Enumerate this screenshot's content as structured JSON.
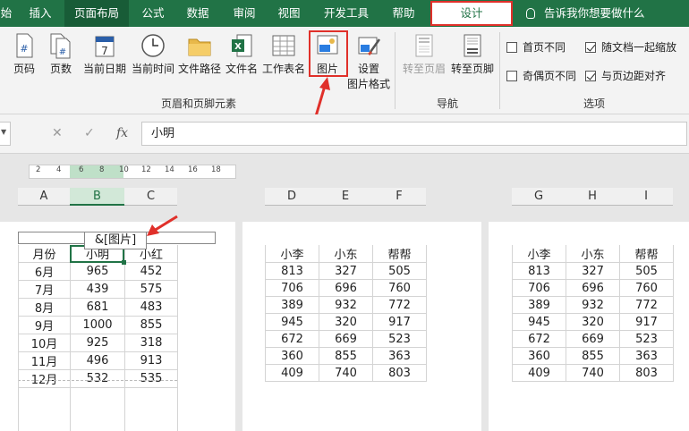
{
  "tabs": [
    "始",
    "插入",
    "页面布局",
    "公式",
    "数据",
    "审阅",
    "视图",
    "开发工具",
    "帮助",
    "设计"
  ],
  "tell_me": "告诉我你想要做什么",
  "ribbon": {
    "elements_buttons": [
      "页码",
      "页数",
      "当前日期",
      "当前时间",
      "文件路径",
      "文件名",
      "工作表名",
      "图片"
    ],
    "format_picture_line1": "设置",
    "format_picture_line2": "图片格式",
    "group_elements": "页眉和页脚元素",
    "nav_goto_header": "转至页眉",
    "nav_goto_footer": "转至页脚",
    "group_nav": "导航",
    "options": {
      "diff_first": "首页不同",
      "diff_odd_even": "奇偶页不同",
      "scale_with_doc": "随文档一起缩放",
      "align_margins": "与页边距对齐",
      "group": "选项"
    }
  },
  "formula": {
    "cancel": "✕",
    "enter": "✓",
    "fx": "fx",
    "value": "小明"
  },
  "ruler_ticks": [
    "2",
    "4",
    "6",
    "8",
    "10",
    "12",
    "14",
    "16",
    "18"
  ],
  "columns": [
    "A",
    "B",
    "C",
    "D",
    "E",
    "F",
    "G",
    "H",
    "I"
  ],
  "header_field": "&[图片]",
  "page1": {
    "headers": [
      "月份",
      "小明",
      "小红"
    ],
    "rows": [
      [
        "6月",
        "965",
        "452"
      ],
      [
        "7月",
        "439",
        "575"
      ],
      [
        "8月",
        "681",
        "483"
      ],
      [
        "9月",
        "1000",
        "855"
      ],
      [
        "10月",
        "925",
        "318"
      ],
      [
        "11月",
        "496",
        "913"
      ],
      [
        "12月",
        "532",
        "535"
      ]
    ]
  },
  "page2": {
    "headers": [
      "小李",
      "小东",
      "帮帮"
    ],
    "rows": [
      [
        "813",
        "327",
        "505"
      ],
      [
        "706",
        "696",
        "760"
      ],
      [
        "389",
        "932",
        "772"
      ],
      [
        "945",
        "320",
        "917"
      ],
      [
        "672",
        "669",
        "523"
      ],
      [
        "360",
        "855",
        "363"
      ],
      [
        "409",
        "740",
        "803"
      ]
    ]
  },
  "page3": {
    "headers": [
      "小李",
      "小东",
      "帮帮"
    ],
    "rows": [
      [
        "813",
        "327",
        "505"
      ],
      [
        "706",
        "696",
        "760"
      ],
      [
        "389",
        "932",
        "772"
      ],
      [
        "945",
        "320",
        "917"
      ],
      [
        "672",
        "669",
        "523"
      ],
      [
        "360",
        "855",
        "363"
      ],
      [
        "409",
        "740",
        "803"
      ]
    ]
  },
  "colors": {
    "excel_green": "#217346",
    "highlight_red": "#e0302a"
  }
}
